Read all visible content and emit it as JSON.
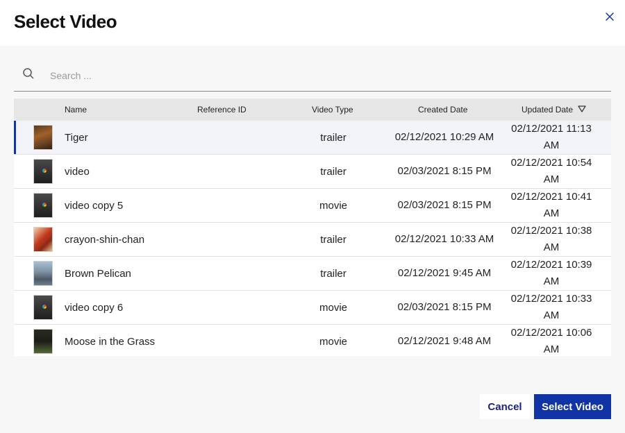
{
  "dialog": {
    "title": "Select Video"
  },
  "search": {
    "placeholder": "Search ..."
  },
  "table": {
    "columns": {
      "name": "Name",
      "reference_id": "Reference ID",
      "video_type": "Video Type",
      "created_date": "Created Date",
      "updated_date": "Updated Date"
    },
    "sort_icon": "triangle-down-icon",
    "rows": [
      {
        "name": "Tiger",
        "reference_id": "",
        "type": "trailer",
        "created": "02/12/2021 10:29 AM",
        "updated": "02/12/2021 11:13 AM",
        "thumb": "tiger",
        "selected": true
      },
      {
        "name": "video",
        "reference_id": "",
        "type": "trailer",
        "created": "02/03/2021 8:15 PM",
        "updated": "02/12/2021 10:54 AM",
        "thumb": "dark"
      },
      {
        "name": "video copy 5",
        "reference_id": "",
        "type": "movie",
        "created": "02/03/2021 8:15 PM",
        "updated": "02/12/2021 10:41 AM",
        "thumb": "dark"
      },
      {
        "name": "crayon-shin-chan",
        "reference_id": "",
        "type": "trailer",
        "created": "02/12/2021 10:33 AM",
        "updated": "02/12/2021 10:38 AM",
        "thumb": "crayon"
      },
      {
        "name": "Brown Pelican",
        "reference_id": "",
        "type": "trailer",
        "created": "02/12/2021 9:45 AM",
        "updated": "02/12/2021 10:39 AM",
        "thumb": "pelican"
      },
      {
        "name": "video copy 6",
        "reference_id": "",
        "type": "movie",
        "created": "02/03/2021 8:15 PM",
        "updated": "02/12/2021 10:33 AM",
        "thumb": "dark"
      },
      {
        "name": "Moose in the Grass",
        "reference_id": "",
        "type": "movie",
        "created": "02/12/2021 9:48 AM",
        "updated": "02/12/2021 10:06 AM",
        "thumb": "moose"
      }
    ]
  },
  "footer": {
    "cancel_label": "Cancel",
    "select_label": "Select Video"
  },
  "colors": {
    "accent": "#1034a6",
    "header_bg": "#e6e6e6",
    "selected_row_bg": "#f2f4f9"
  }
}
